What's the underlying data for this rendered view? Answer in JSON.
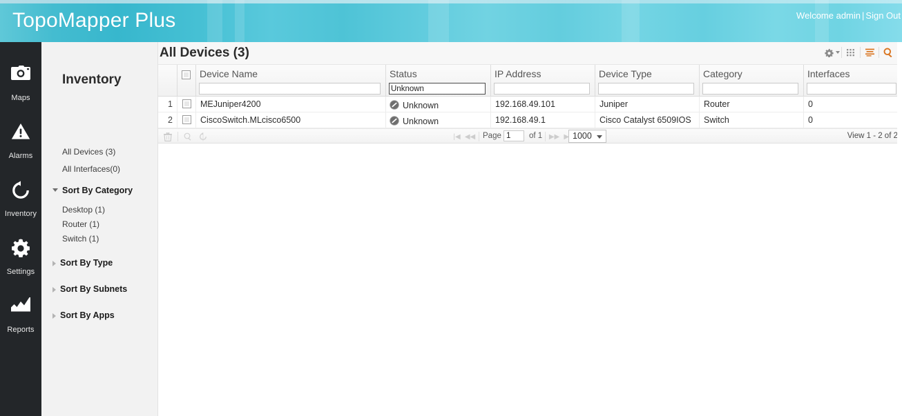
{
  "header": {
    "app_title": "TopoMapper Plus",
    "welcome_text": "Welcome admin",
    "separator": "|",
    "sign_out": "Sign Out",
    "brand_color": "#4ec3d6"
  },
  "rail": {
    "items": [
      {
        "label": "Maps",
        "icon": "camera-icon"
      },
      {
        "label": "Alarms",
        "icon": "warning-triangle-icon"
      },
      {
        "label": "Inventory",
        "icon": "refresh-circular-arrow-icon"
      },
      {
        "label": "Settings",
        "icon": "gear-icon"
      },
      {
        "label": "Reports",
        "icon": "chart-icon"
      }
    ]
  },
  "tree": {
    "title": "Inventory",
    "links": [
      {
        "label": "All Devices (3)"
      },
      {
        "label": "All Interfaces(0)"
      }
    ],
    "groups": [
      {
        "label": "Sort By Category",
        "expanded": true,
        "children": [
          {
            "label": "Desktop (1)"
          },
          {
            "label": "Router (1)"
          },
          {
            "label": "Switch (1)"
          }
        ]
      },
      {
        "label": "Sort By Type",
        "expanded": false,
        "children": []
      },
      {
        "label": "Sort By Subnets",
        "expanded": false,
        "children": []
      },
      {
        "label": "Sort By Apps",
        "expanded": false,
        "children": []
      }
    ]
  },
  "page": {
    "title": "All Devices (3)",
    "tools": [
      {
        "name": "gear-icon",
        "color": "#8a8a8a",
        "has_caret": true
      },
      {
        "name": "grid-columns-icon",
        "color": "#8a8a8a",
        "has_caret": false
      },
      {
        "name": "list-lines-icon",
        "color": "#d9741f",
        "has_caret": false
      },
      {
        "name": "search-icon",
        "color": "#d9741f",
        "has_caret": false
      }
    ]
  },
  "grid": {
    "columns": [
      {
        "key": "rownum",
        "label": "",
        "filter": null
      },
      {
        "key": "select",
        "label": "",
        "filter": null
      },
      {
        "key": "device_name",
        "label": "Device Name",
        "filter": ""
      },
      {
        "key": "status",
        "label": "Status",
        "filter": "Unknown",
        "focused": true
      },
      {
        "key": "ip_address",
        "label": "IP Address",
        "filter": ""
      },
      {
        "key": "device_type",
        "label": "Device Type",
        "filter": ""
      },
      {
        "key": "category",
        "label": "Category",
        "filter": ""
      },
      {
        "key": "interfaces",
        "label": "Interfaces",
        "filter": ""
      }
    ],
    "rows": [
      {
        "rownum": "1",
        "device_name": "MEJuniper4200",
        "status": "Unknown",
        "status_icon": "unknown-slash-icon",
        "ip_address": "192.168.49.101",
        "device_type": "Juniper",
        "category": "Router",
        "interfaces": "0"
      },
      {
        "rownum": "2",
        "device_name": "CiscoSwitch.MLcisco6500",
        "status": "Unknown",
        "status_icon": "unknown-slash-icon",
        "ip_address": "192.168.49.1",
        "device_type": "Cisco Catalyst 6509IOS",
        "category": "Switch",
        "interfaces": "0"
      }
    ]
  },
  "pager": {
    "actions": [
      {
        "name": "delete-icon"
      },
      {
        "name": "search-icon"
      },
      {
        "name": "refresh-icon"
      }
    ],
    "first_label": "|◀",
    "prev_label": "◀◀",
    "page_label": "Page",
    "page_value": "1",
    "of_label": "of 1",
    "next_label": "▶▶",
    "last_label": "▶|",
    "page_size": "1000",
    "view_text": "View 1 - 2 of 2"
  }
}
